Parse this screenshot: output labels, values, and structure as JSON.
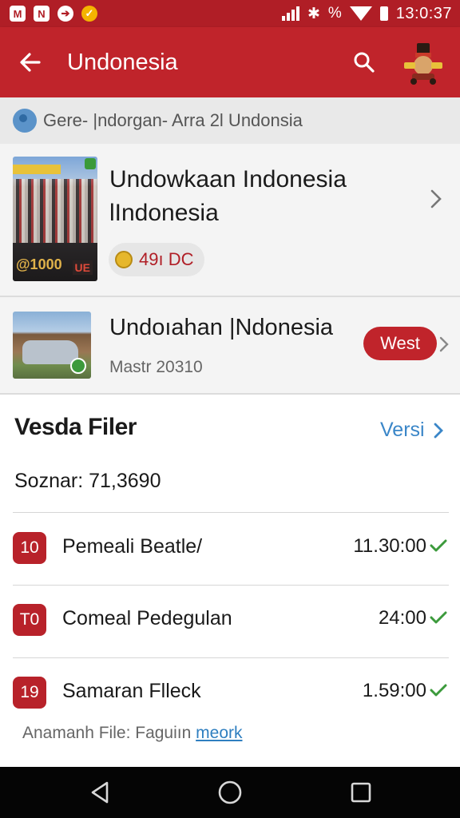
{
  "status_bar": {
    "app_icons": [
      "M",
      "N",
      "➔",
      "✓"
    ],
    "time": "13:0:37"
  },
  "app_bar": {
    "title": "Undonesia"
  },
  "breadcrumb": {
    "text": "Gere- |ndorgan- Arra 2l Undonsia"
  },
  "cards": [
    {
      "title": "Undowkaan Indonesia lIndonesia",
      "thumbnail_text": "@1000",
      "thumbnail_badge": "UE",
      "badge": "49ı DC"
    },
    {
      "title": "Undoıahan |Ndonesia",
      "subtitle": "Mastr 20310",
      "button": "West"
    }
  ],
  "section": {
    "title": "Vesda Filer",
    "link": "Versi",
    "summary": "Soznar: 71,3690"
  },
  "rows": [
    {
      "num": "10",
      "label": "Pemeali Beatle/",
      "time": "11.30:00"
    },
    {
      "num": "T0",
      "label": "Comeal Pedegulan",
      "time": "24:00"
    },
    {
      "num": "19",
      "label": "Samaran Flleck",
      "time": "1.59:00"
    }
  ],
  "footer": {
    "text": "Anamanh File:  Faguiın",
    "link": "meork"
  },
  "colors": {
    "primary_red": "#c0242b",
    "status_red": "#b01e26",
    "link_blue": "#3a86c8",
    "check_green": "#3c9a3c"
  }
}
